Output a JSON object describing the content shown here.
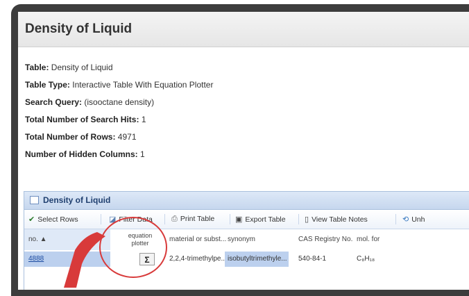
{
  "window": {
    "title": "Density of Liquid"
  },
  "info": [
    {
      "key": "Table:",
      "value": "Density of Liquid"
    },
    {
      "key": "Table Type:",
      "value": "Interactive Table With Equation Plotter"
    },
    {
      "key": "Search Query:",
      "value": "(isooctane density)"
    },
    {
      "key": "Total Number of Search Hits:",
      "value": "1"
    },
    {
      "key": "Total Number of Rows:",
      "value": "4971"
    },
    {
      "key": "Number of Hidden Columns:",
      "value": "1"
    }
  ],
  "panel": {
    "title": "Density of Liquid"
  },
  "toolbar": {
    "select_rows": "Select Rows",
    "filter_data": "Filter Data",
    "print_table": "Print Table",
    "export_table": "Export Table",
    "view_table_notes": "View Table Notes",
    "unhide": "Unh"
  },
  "columns": {
    "no": "no. ▲",
    "equation_plotter_1": "equation",
    "equation_plotter_2": "plotter",
    "material": "material or subst...",
    "synonym": "synonym",
    "cas": "CAS Registry No.",
    "formula": "mol. for"
  },
  "row": {
    "no": "4888",
    "equation_button": "Σ",
    "material": "2,2,4-trimethylpe...",
    "synonym": "isobutyltrimethyle...",
    "cas": "540-84-1",
    "formula": "C₈H₁₈"
  },
  "colors": {
    "highlight": "#bcd0ee",
    "callout": "#d83a3a",
    "panel_border": "#a9c0dd"
  }
}
